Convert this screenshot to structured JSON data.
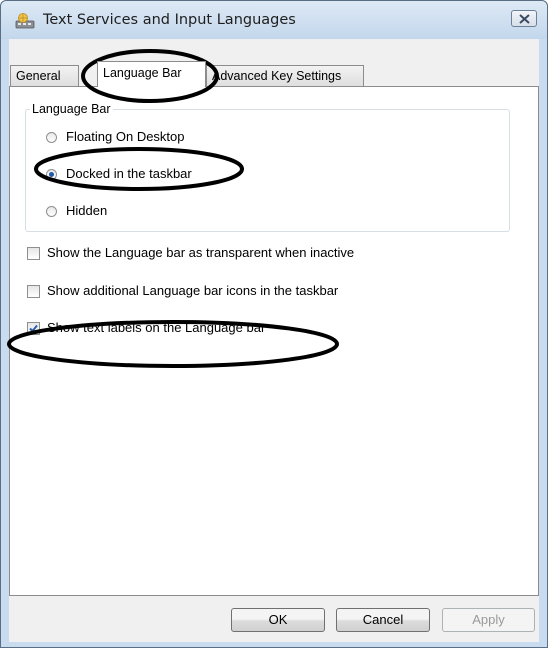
{
  "window": {
    "title": "Text Services and Input Languages",
    "title_icon": "keyboard-globe-icon",
    "close_icon": "close-icon"
  },
  "tabs": [
    {
      "label": "General",
      "selected": false
    },
    {
      "label": "Language Bar",
      "selected": true
    },
    {
      "label": "Advanced Key Settings",
      "selected": false
    }
  ],
  "language_bar_group": {
    "label": "Language Bar",
    "options": [
      {
        "label": "Floating On Desktop",
        "checked": false
      },
      {
        "label": "Docked in the taskbar",
        "checked": true
      },
      {
        "label": "Hidden",
        "checked": false
      }
    ]
  },
  "checkboxes": [
    {
      "label": "Show the Language bar as transparent when inactive",
      "checked": false
    },
    {
      "label": "Show additional Language bar icons in the taskbar",
      "checked": false
    },
    {
      "label": "Show text labels on the Language bar",
      "checked": true
    }
  ],
  "buttons": {
    "ok": "OK",
    "cancel": "Cancel",
    "apply": "Apply"
  },
  "annotation_color": "#000000"
}
